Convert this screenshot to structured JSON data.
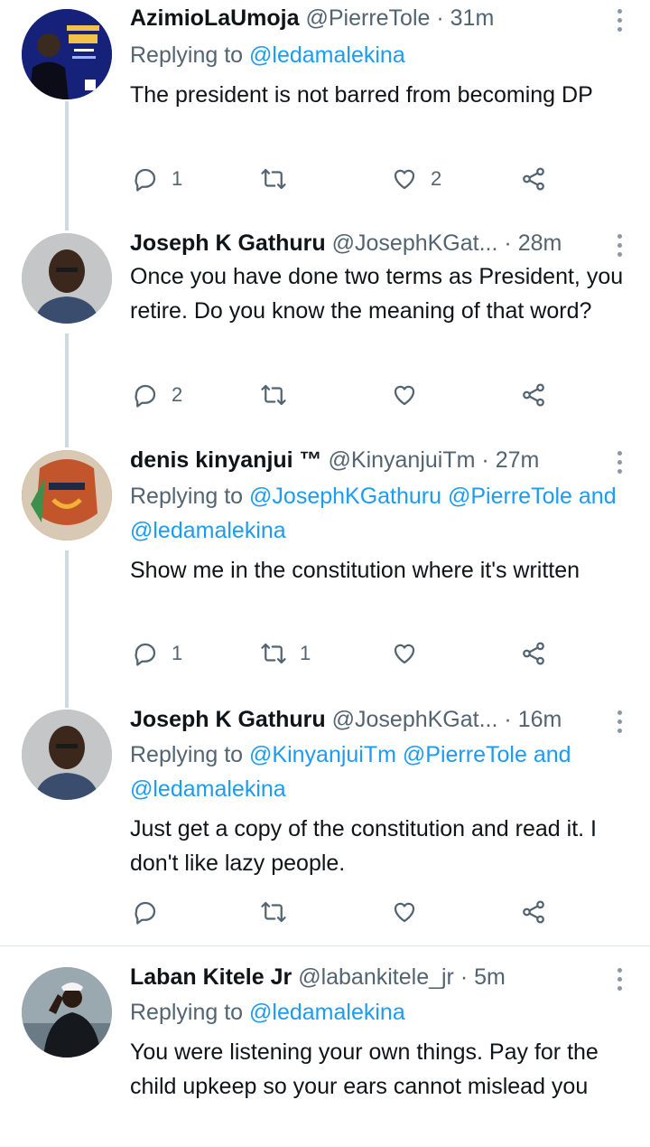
{
  "tweets": [
    {
      "name": "AzimioLaUmoja",
      "handle": "@PierreTole",
      "time": "31m",
      "reply_prefix": "Replying to",
      "reply_mentions": [
        "@ledamalekina"
      ],
      "reply_line2": "",
      "text": "The president is not barred from becoming DP",
      "counts": {
        "reply": "1",
        "retweet": "",
        "like": "2"
      },
      "avatar_text": [
        "AZIMIO LA",
        "UMOJA"
      ]
    },
    {
      "name": "Joseph K Gathuru",
      "handle": "@JosephKGat...",
      "time": "28m",
      "text": "Once you have done two terms as President, you retire. Do you know the meaning of that word?",
      "counts": {
        "reply": "2",
        "retweet": "",
        "like": ""
      }
    },
    {
      "name": "denis kinyanjui ™",
      "handle": "@KinyanjuiTm",
      "time": "27m",
      "reply_prefix": "Replying to",
      "reply_mention_1": "@JosephKGathuru",
      "reply_mention_2": "@PierreTole",
      "reply_and": "and",
      "reply_mention_3": "@ledamalekina",
      "text": "Show me in the constitution where it's written",
      "counts": {
        "reply": "1",
        "retweet": "1",
        "like": ""
      }
    },
    {
      "name": "Joseph K Gathuru",
      "handle": "@JosephKGat...",
      "time": "16m",
      "reply_prefix": "Replying to",
      "reply_mention_1": "@KinyanjuiTm",
      "reply_mention_2": "@PierreTole",
      "reply_and": "and",
      "reply_mention_3": "@ledamalekina",
      "text": "Just get a copy of the constitution and read it. I don't like lazy people.",
      "counts": {
        "reply": "",
        "retweet": "",
        "like": ""
      }
    },
    {
      "name": "Laban Kitele Jr",
      "handle": "@labankitele_jr",
      "time": "5m",
      "reply_prefix": "Replying to",
      "reply_mention_1": "@ledamalekina",
      "text": "You were listening your own things. Pay for the child upkeep so your ears cannot mislead you"
    }
  ],
  "separator": "·",
  "colors": {
    "link": "#1d9bf0",
    "muted": "#536471",
    "text": "#0f1419",
    "thread": "#cfd9de"
  },
  "icons": [
    "reply-icon",
    "retweet-icon",
    "like-icon",
    "share-icon",
    "more-icon"
  ]
}
